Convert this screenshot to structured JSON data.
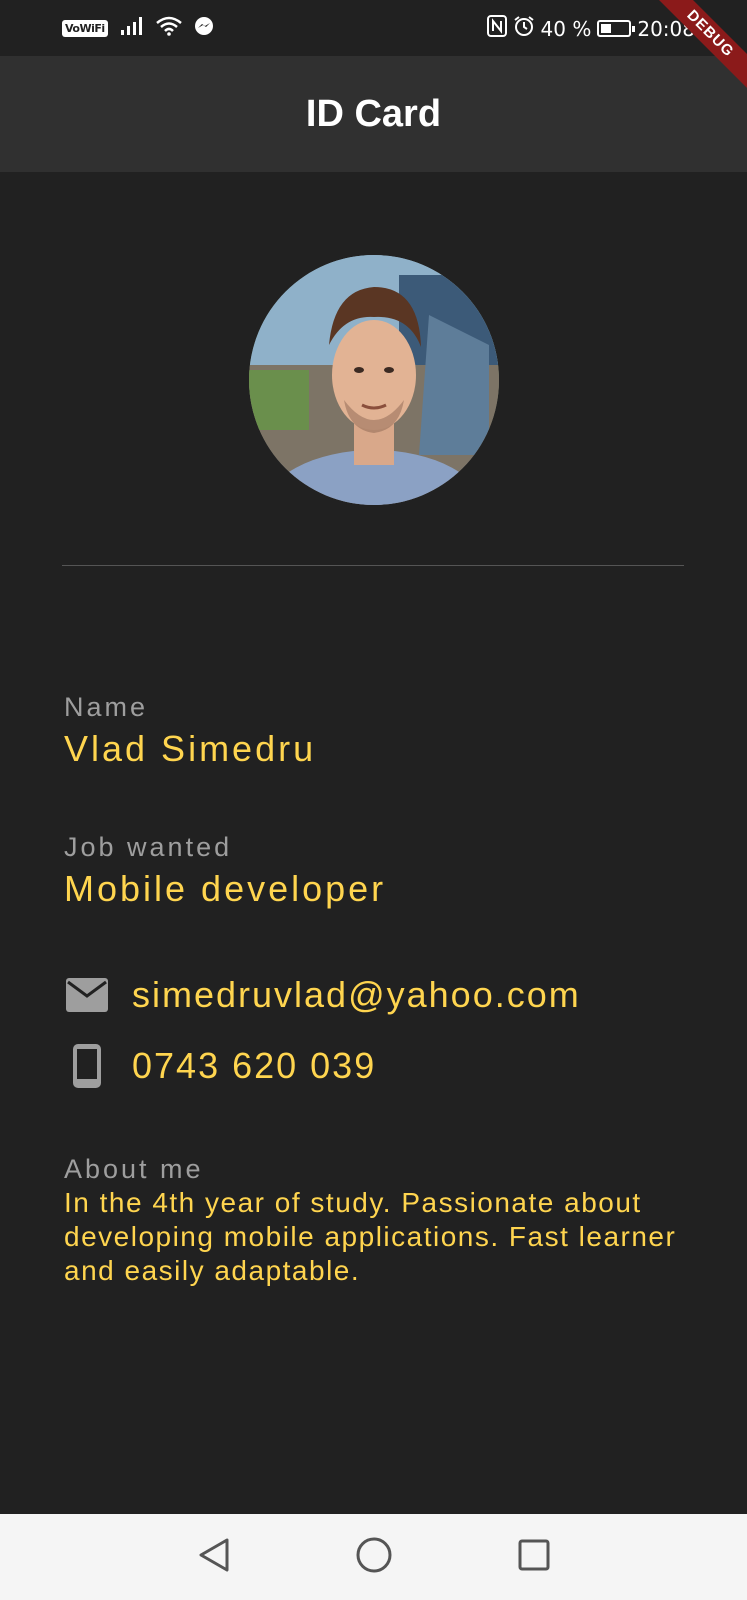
{
  "status_bar": {
    "vowifi": "VoWiFi",
    "battery_percent": "40 %",
    "battery_level": 0.4,
    "time": "20:08",
    "icons": [
      "signal-icon",
      "wifi-icon",
      "messenger-icon",
      "nfc-icon",
      "alarm-icon",
      "battery-charging-icon"
    ]
  },
  "debug_banner": "DEBUG",
  "app_bar": {
    "title": "ID Card"
  },
  "profile": {
    "name_label": "Name",
    "name": "Vlad Simedru",
    "job_label": "Job wanted",
    "job": "Mobile developer",
    "email": "simedruvlad@yahoo.com",
    "phone": "0743 620 039",
    "about_label": "About me",
    "about": "In the 4th year of study. Passionate about developing mobile applications. Fast learner and easily adaptable."
  },
  "colors": {
    "background": "#212121",
    "app_bar": "#303030",
    "accent": "#ffd54f",
    "label": "#9e9e9e",
    "icon": "#9e9e9e"
  },
  "nav_bar": {
    "buttons": [
      "back-icon",
      "home-icon",
      "recents-icon"
    ]
  }
}
